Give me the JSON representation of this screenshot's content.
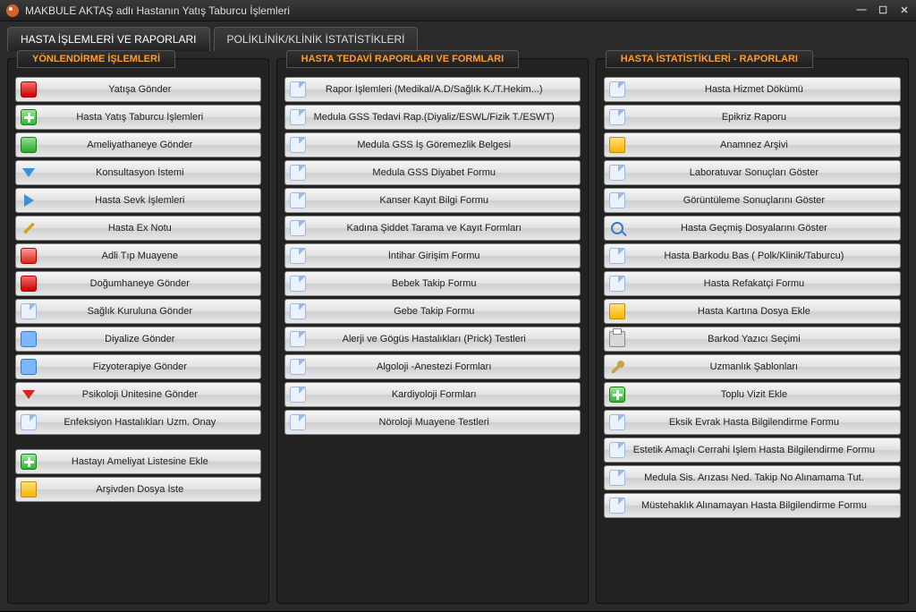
{
  "window": {
    "title": "MAKBULE AKTAŞ adlı Hastanın Yatış Taburcu İşlemleri"
  },
  "tabs": {
    "t0": "HASTA İŞLEMLERİ VE RAPORLARI",
    "t1": "POLİKLİNİK/KLİNİK İSTATİSTİKLERİ"
  },
  "panels": {
    "p0": {
      "title": "YÖNLENDİRME İŞLEMLERİ",
      "items": [
        "Yatışa Gönder",
        "Hasta Yatış Taburcu İşlemleri",
        "Ameliyathaneye Gönder",
        "Konsultasyon İstemi",
        "Hasta Sevk İşlemleri",
        "Hasta Ex Notu",
        "Adli Tıp Muayene",
        "Doğumhaneye Gönder",
        "Sağlık Kuruluna Gönder",
        "Diyalize Gönder",
        "Fizyoterapiye Gönder",
        "Psikoloji Ünitesine Gönder",
        "Enfeksiyon Hastalıkları Uzm. Onay",
        "Hastayı Ameliyat Listesine Ekle",
        "Arşivden Dosya İste"
      ]
    },
    "p1": {
      "title": "HASTA TEDAVİ RAPORLARI VE FORMLARI",
      "items": [
        "Rapor İşlemleri (Medikal/A.D/Sağlık K./T.Hekim...)",
        "Medula GSS Tedavi Rap.(Diyaliz/ESWL/Fizik T./ESWT)",
        "Medula GSS İş Göremezlik Belgesi",
        "Medula GSS Diyabet Formu",
        "Kanser Kayıt Bilgi Formu",
        "Kadına Şiddet Tarama ve Kayıt Formları",
        "İntihar Girişim Formu",
        "Bebek Takip Formu",
        "Gebe Takip Formu",
        "Alerji ve Gögüs Hastalıkları (Prick) Testleri",
        "Algoloji -Anestezi Formları",
        "Kardiyoloji Formları",
        "Nöroloji Muayene Testleri"
      ]
    },
    "p2": {
      "title": "HASTA İSTATİSTİKLERİ - RAPORLARI",
      "items": [
        "Hasta Hizmet Dökümü",
        "Epikriz Raporu",
        "Anamnez Arşivi",
        "Laboratuvar Sonuçları Göster",
        "Görüntüleme Sonuçlarını Göster",
        "Hasta Geçmiş Dosyalarını Göster",
        "Hasta Barkodu Bas ( Polk/Klinik/Taburcu)",
        "Hasta Refakatçi Formu",
        "Hasta Kartına  Dosya Ekle",
        "Barkod Yazıcı Seçimi",
        "Uzmanlık Şablonları",
        "Toplu Vizit Ekle",
        "Eksik Evrak Hasta Bilgilendirme Formu",
        "Estetik Amaçlı Cerrahi İşlem Hasta Bilgilendirme Formu",
        "Medula Sis. Arızası Ned. Takip No Alınamama Tut.",
        "Müstehaklık Alınamayan Hasta Bilgilendirme Formu"
      ]
    }
  }
}
